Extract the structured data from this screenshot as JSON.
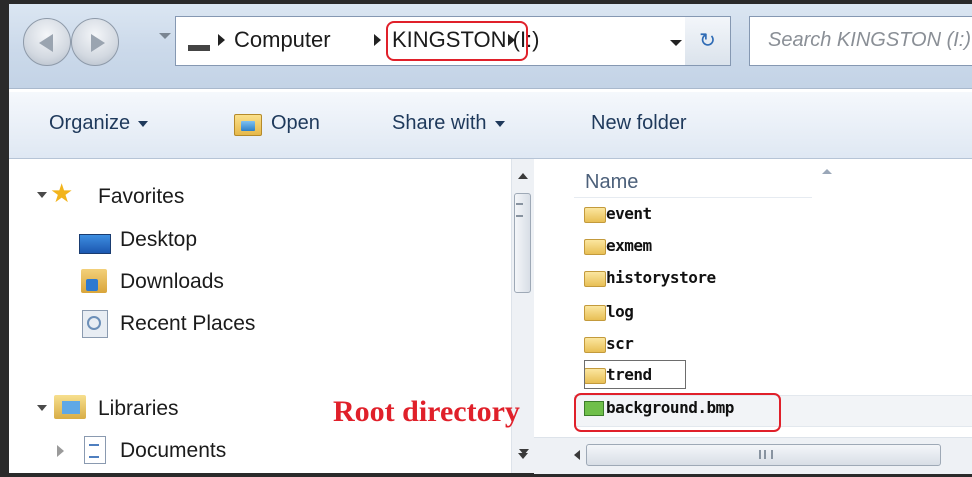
{
  "address_bar": {
    "crumbs": [
      "Computer",
      "KINGSTON (I:)"
    ],
    "search_placeholder": "Search KINGSTON (I:)"
  },
  "command_bar": {
    "organize": "Organize",
    "open": "Open",
    "share_with": "Share with",
    "new_folder": "New folder"
  },
  "nav_pane": {
    "favorites": "Favorites",
    "favorites_items": [
      "Desktop",
      "Downloads",
      "Recent Places"
    ],
    "libraries": "Libraries",
    "libraries_items": [
      "Documents"
    ]
  },
  "file_list": {
    "column_name": "Name",
    "folders": [
      "event",
      "exmem",
      "historystore",
      "log",
      "scr",
      "trend"
    ],
    "files": [
      "background.bmp"
    ]
  },
  "annotation": {
    "root_label": "Root directory",
    "highlight_color": "#e0202a"
  },
  "icons": [
    "back-arrow-icon",
    "forward-arrow-icon",
    "refresh-icon",
    "star-icon",
    "folder-icon",
    "bitmap-icon",
    "library-icon",
    "document-icon"
  ]
}
